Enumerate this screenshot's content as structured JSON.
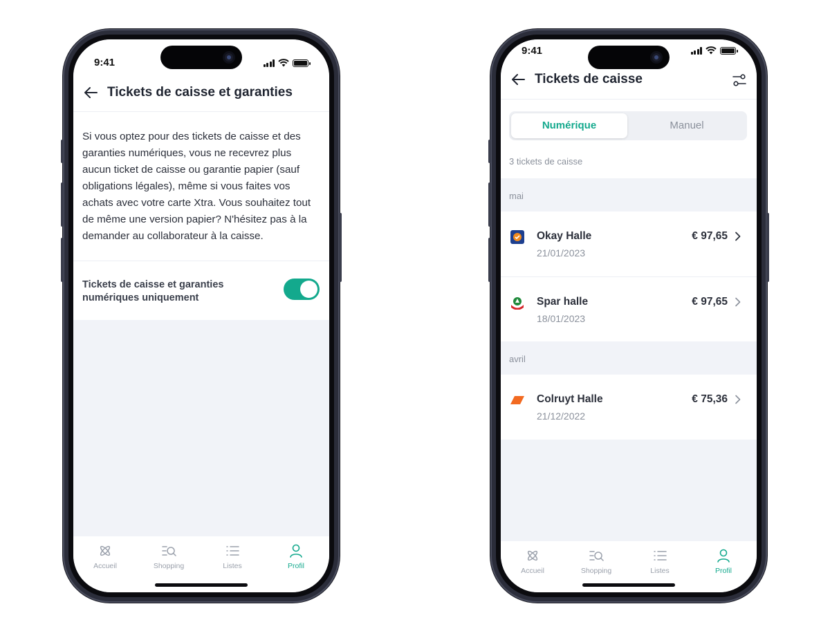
{
  "colors": {
    "accent": "#13a98d",
    "frame": "#2b2d3a",
    "muted": "#8a909b",
    "bg": "#f1f3f8"
  },
  "status": {
    "time": "9:41"
  },
  "left_screen": {
    "title": "Tickets de caisse et garanties",
    "info": "Si vous optez pour des tickets de caisse et des garanties numériques, vous ne recevrez plus aucun ticket de caisse ou garantie papier (sauf obligations légales), même si vous faites vos achats avec votre carte Xtra. Vous souhaitez tout de même une version papier? N'hésitez pas à la demander au collaborateur à la caisse.",
    "toggle": {
      "label": "Tickets de caisse et garanties numériques uniquement",
      "on": true
    }
  },
  "right_screen": {
    "title": "Tickets de caisse",
    "tabs": {
      "active": "Numérique",
      "inactive": "Manuel"
    },
    "count": "3 tickets de caisse",
    "groups": [
      {
        "month": "mai",
        "items": [
          {
            "store": "Okay Halle",
            "date": "21/01/2023",
            "amount": "€ 97,65",
            "logo": "okay-logo-icon"
          },
          {
            "store": "Spar halle",
            "date": "18/01/2023",
            "amount": "€ 97,65",
            "logo": "spar-logo-icon"
          }
        ]
      },
      {
        "month": "avril",
        "items": [
          {
            "store": "Colruyt Halle",
            "date": "21/12/2022",
            "amount": "€ 75,36",
            "logo": "colruyt-logo-icon"
          }
        ]
      }
    ]
  },
  "nav": {
    "tabs": [
      {
        "label": "Accueil",
        "icon": "home-icon"
      },
      {
        "label": "Shopping",
        "icon": "shopping-search-icon"
      },
      {
        "label": "Listes",
        "icon": "list-icon"
      },
      {
        "label": "Profil",
        "icon": "profile-icon",
        "active": true
      }
    ]
  }
}
